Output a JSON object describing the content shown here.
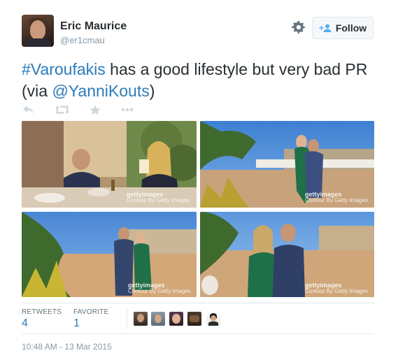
{
  "user": {
    "name": "Eric Maurice",
    "handle": "@er1cmau",
    "follow_label": "Follow"
  },
  "tweet": {
    "hashtag": "#Varoufakis",
    "text_main": " has a good lifestyle but very bad PR (via ",
    "mention": "@YanniKouts",
    "text_end": ")"
  },
  "actions": [
    "reply-icon",
    "retweet-icon",
    "favorite-icon",
    "more-icon"
  ],
  "photos": [
    {
      "watermark_brand": "gettyimages",
      "watermark_credit": "Contour By Getty Images"
    },
    {
      "watermark_brand": "gettyimages",
      "watermark_credit": "Contour By Getty Images"
    },
    {
      "watermark_brand": "gettyimages",
      "watermark_credit": "Contour By Getty Images"
    },
    {
      "watermark_brand": "gettyimages",
      "watermark_credit": "Contour By Getty Images"
    }
  ],
  "stats": {
    "retweets_label": "RETWEETS",
    "retweets_count": "4",
    "favorites_label": "FAVORITE",
    "favorites_count": "1"
  },
  "timestamp": "10:48 AM - 13 Mar 2015",
  "colors": {
    "link": "#2b7bb9",
    "text": "#292f33",
    "muted": "#8899a6",
    "border": "#e1e8ed"
  }
}
